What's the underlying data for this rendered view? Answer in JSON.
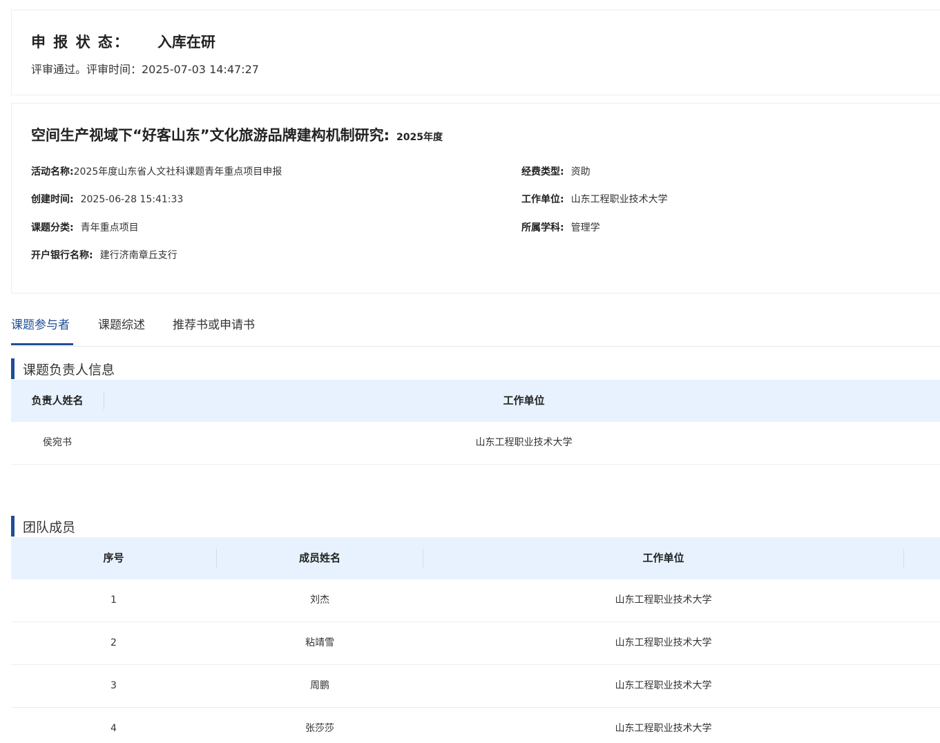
{
  "status": {
    "label": "申 报 状 态：",
    "value": "入库在研",
    "review_text": "评审通过。评审时间：2025-07-03 14:47:27"
  },
  "project": {
    "title": "空间生产视域下“好客山东”文化旅游品牌建构机制研究:",
    "year": "2025年度",
    "fields": {
      "activity_label": "活动名称:",
      "activity_value": "2025年度山东省人文社科课题青年重点项目申报",
      "created_label": "创建时间:",
      "created_value": "2025-06-28 15:41:33",
      "category_label": "课题分类:",
      "category_value": "青年重点项目",
      "bank_label": "开户银行名称:",
      "bank_value": "建行济南章丘支行",
      "funding_label": "经费类型:",
      "funding_value": "资助",
      "unit_label": "工作单位:",
      "unit_value": "山东工程职业技术大学",
      "discipline_label": "所属学科:",
      "discipline_value": "管理学"
    }
  },
  "tabs": [
    {
      "label": "课题参与者",
      "active": true
    },
    {
      "label": "课题综述",
      "active": false
    },
    {
      "label": "推荐书或申请书",
      "active": false
    }
  ],
  "leader_section": {
    "title": "课题负责人信息",
    "headers": {
      "name": "负责人姓名",
      "unit": "工作单位"
    },
    "rows": [
      {
        "name": "侯宛书",
        "unit": "山东工程职业技术大学"
      }
    ]
  },
  "team_section": {
    "title": "团队成员",
    "headers": {
      "index": "序号",
      "name": "成员姓名",
      "unit": "工作单位"
    },
    "rows": [
      {
        "index": "1",
        "name": "刘杰",
        "unit": "山东工程职业技术大学"
      },
      {
        "index": "2",
        "name": "粘靖雪",
        "unit": "山东工程职业技术大学"
      },
      {
        "index": "3",
        "name": "周鹏",
        "unit": "山东工程职业技术大学"
      },
      {
        "index": "4",
        "name": "张莎莎",
        "unit": "山东工程职业技术大学"
      }
    ]
  },
  "colors": {
    "accent": "#1f4e96",
    "table_header_bg": "#e8f2fe"
  }
}
